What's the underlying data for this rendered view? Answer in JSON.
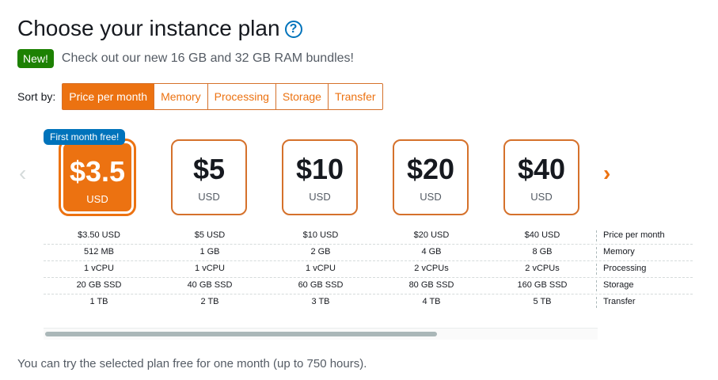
{
  "header": {
    "title": "Choose your instance plan",
    "help_icon": "?"
  },
  "announcement": {
    "badge": "New!",
    "text": "Check out our new 16 GB and 32 GB RAM bundles!"
  },
  "sort": {
    "label": "Sort by:",
    "options": [
      "Price per month",
      "Memory",
      "Processing",
      "Storage",
      "Transfer"
    ],
    "selected": "Price per month"
  },
  "carousel": {
    "prev_icon": "‹",
    "next_icon": "›",
    "free_badge": "First month free!",
    "plans": [
      {
        "price": "$3.5",
        "unit": "USD",
        "selected": true
      },
      {
        "price": "$5",
        "unit": "USD",
        "selected": false
      },
      {
        "price": "$10",
        "unit": "USD",
        "selected": false
      },
      {
        "price": "$20",
        "unit": "USD",
        "selected": false
      },
      {
        "price": "$40",
        "unit": "USD",
        "selected": false
      }
    ]
  },
  "specs": {
    "rows": [
      {
        "label": "Price per month",
        "values": [
          "$3.50 USD",
          "$5 USD",
          "$10 USD",
          "$20 USD",
          "$40 USD"
        ]
      },
      {
        "label": "Memory",
        "values": [
          "512 MB",
          "1 GB",
          "2 GB",
          "4 GB",
          "8 GB"
        ]
      },
      {
        "label": "Processing",
        "values": [
          "1 vCPU",
          "1 vCPU",
          "1 vCPU",
          "2 vCPUs",
          "2 vCPUs"
        ]
      },
      {
        "label": "Storage",
        "values": [
          "20 GB SSD",
          "40 GB SSD",
          "60 GB SSD",
          "80 GB SSD",
          "160 GB SSD"
        ]
      },
      {
        "label": "Transfer",
        "values": [
          "1 TB",
          "2 TB",
          "3 TB",
          "4 TB",
          "5 TB"
        ]
      }
    ]
  },
  "footer": {
    "note": "You can try the selected plan free for one month (up to 750 hours)."
  },
  "colors": {
    "accent": "#ec7211",
    "info": "#0073bb",
    "success": "#1d8102"
  }
}
